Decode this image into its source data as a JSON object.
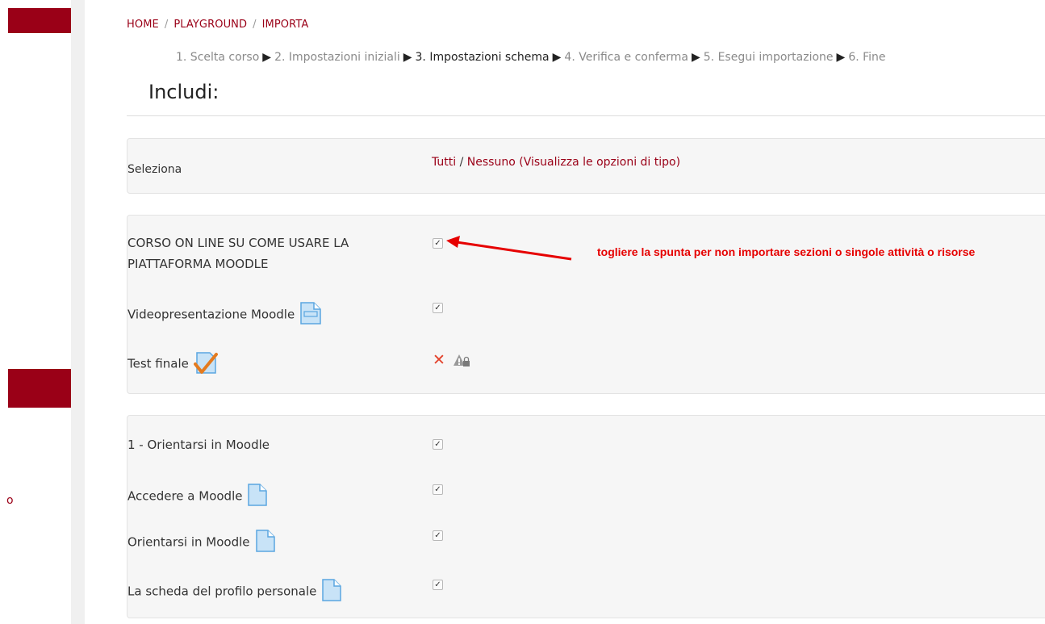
{
  "sidebar": {
    "fragment": "o"
  },
  "breadcrumb": [
    "HOME",
    "PLAYGROUND",
    "IMPORTA"
  ],
  "breadcrumb_sep": "/",
  "steps": [
    {
      "label": "1. Scelta corso",
      "current": false
    },
    {
      "label": "2. Impostazioni iniziali",
      "current": false
    },
    {
      "label": "3. Impostazioni schema",
      "current": true
    },
    {
      "label": "4. Verifica e conferma",
      "current": false
    },
    {
      "label": "5. Esegui importazione",
      "current": false
    },
    {
      "label": "6. Fine",
      "current": false
    }
  ],
  "step_arrow": "▶",
  "heading": "Includi:",
  "select_row": {
    "label": "Seleziona",
    "all": "Tutti",
    "slash": "/",
    "none": "Nessuno",
    "show_types": "(Visualizza le opzioni di tipo)"
  },
  "section0": {
    "title": "CORSO ON LINE SU COME USARE LA PIATTAFORMA MOODLE",
    "checked": true,
    "items": [
      {
        "label": "Videopresentazione Moodle",
        "icon": "page-icon",
        "checked": true
      },
      {
        "label": "Test finale",
        "icon": "quiz-icon",
        "status": "excluded"
      }
    ]
  },
  "annotation": "togliere la spunta per non importare sezioni o singole attività o risorse",
  "section1": {
    "title": "1 - Orientarsi in Moodle",
    "checked": true,
    "items": [
      {
        "label": "Accedere a Moodle",
        "icon": "file-icon",
        "checked": true
      },
      {
        "label": "Orientarsi in Moodle",
        "icon": "file-icon",
        "checked": true
      },
      {
        "label": "La scheda del profilo personale",
        "icon": "file-icon",
        "checked": true
      }
    ]
  },
  "colors": {
    "accent": "#9a0017",
    "annotation": "#e60000"
  }
}
